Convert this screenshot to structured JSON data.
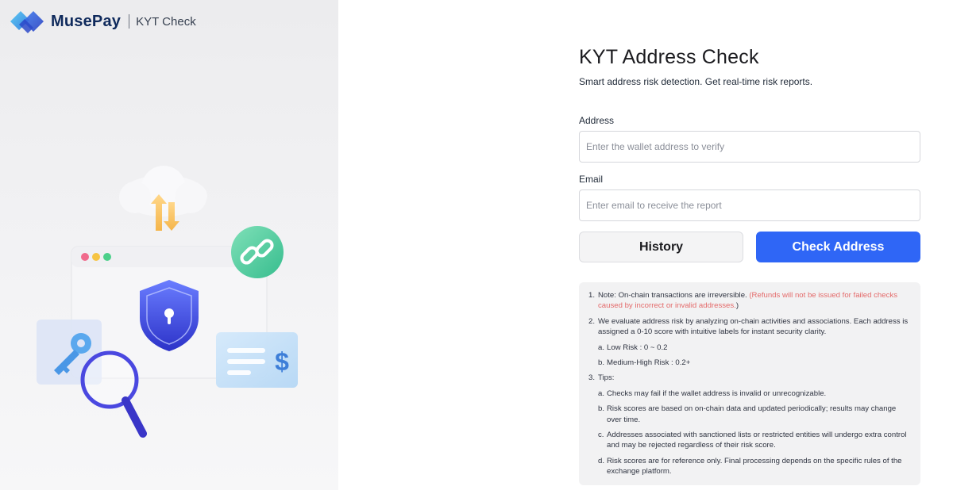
{
  "brand": {
    "name": "MusePay",
    "product": "KYT Check",
    "logo_icon": "musepay-logo-icon"
  },
  "illustration": {
    "icons": [
      "cloud-icon",
      "transfer-arrows-icon",
      "browser-window-icon",
      "shield-lock-icon",
      "link-icon",
      "key-icon",
      "magnifier-icon",
      "payment-card-icon",
      "dollar-icon"
    ]
  },
  "form": {
    "title": "KYT Address Check",
    "subtitle": "Smart address risk detection. Get real-time risk reports.",
    "address_label": "Address",
    "address_placeholder": "Enter the wallet address to verify",
    "email_label": "Email",
    "email_placeholder": "Enter email to receive the report",
    "history_label": "History",
    "check_label": "Check Address"
  },
  "notes": {
    "n1_num": "1.",
    "n1_text": "Note: On-chain transactions are irreversible. ",
    "n1_red": "(Refunds will not be issued for failed checks caused by incorrect or invalid addresses.",
    "n1_close": ")",
    "n2_num": "2.",
    "n2_text": "We evaluate address risk by analyzing on-chain activities and associations. Each address is assigned a 0-10 score with intuitive labels for instant security clarity.",
    "n2a_letter": "a.",
    "n2a_text": "Low Risk : 0 ~ 0.2",
    "n2b_letter": "b.",
    "n2b_text": "Medium-High Risk : 0.2+",
    "n3_num": "3.",
    "n3_text": "Tips:",
    "n3a_letter": "a.",
    "n3a_text": "Checks may fail if the wallet address is invalid or unrecognizable.",
    "n3b_letter": "b.",
    "n3b_text": "Risk scores are based on on-chain data and updated periodically; results may change over time.",
    "n3c_letter": "c.",
    "n3c_text": "Addresses associated with sanctioned lists or restricted entities will undergo extra control and may be rejected regardless of their risk score.",
    "n3d_letter": "d.",
    "n3d_text": "Risk scores are for reference only. Final processing depends on the specific rules of the exchange platform."
  },
  "colors": {
    "accent": "#2f66f6",
    "notice_red": "#e46a6a",
    "brand_navy": "#0f2a5c"
  }
}
